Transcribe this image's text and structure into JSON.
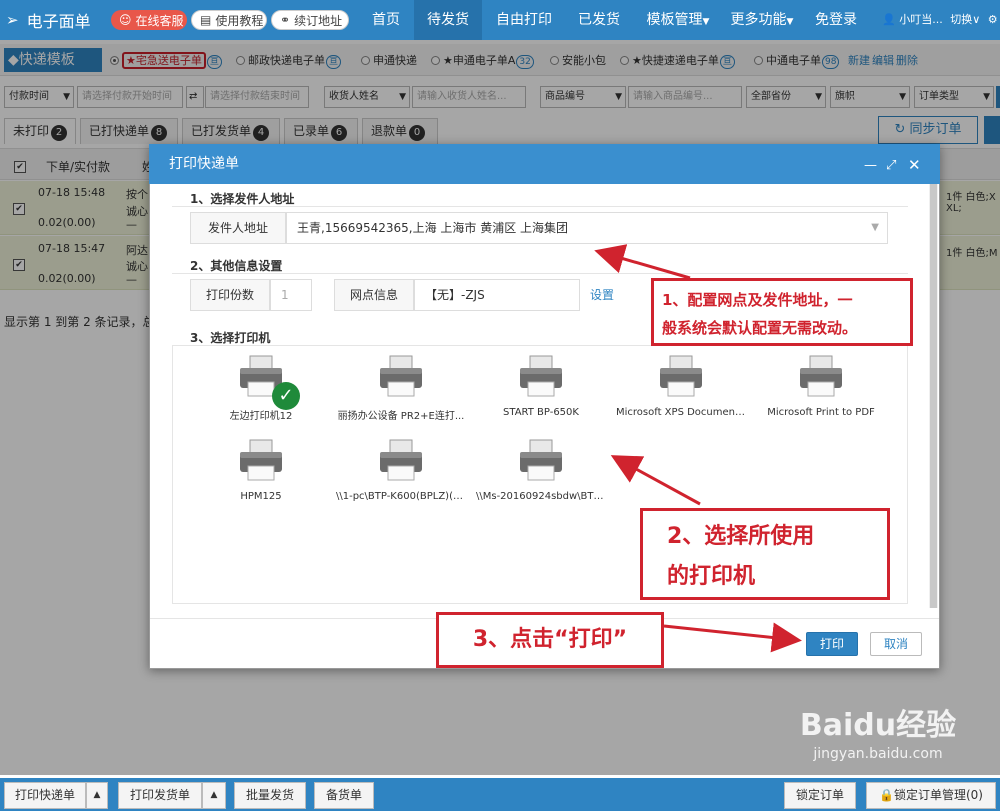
{
  "app": {
    "title": "电子面单",
    "online_service": "在线客服",
    "tutorial": "使用教程",
    "renew": "续订地址"
  },
  "nav": {
    "home": "首页",
    "pending": "待发货",
    "free_print": "自由打印",
    "shipped": "已发货",
    "template_mgmt": "模板管理",
    "more": "更多功能",
    "no_login": "免登录",
    "user": "小叮当...",
    "switch": "切换"
  },
  "templates": {
    "title": "快递模板",
    "items": [
      {
        "label": "★宅急送电子单",
        "badge": "",
        "selected": true
      },
      {
        "label": "邮政快递电子单",
        "badge": "",
        "selected": false
      },
      {
        "label": "申通快递",
        "badge": "",
        "selected": false
      },
      {
        "label": "★申通电子单A",
        "badge": "32",
        "selected": false
      },
      {
        "label": "安能小包",
        "badge": "",
        "selected": false
      },
      {
        "label": "★快捷速递电子单",
        "badge": "",
        "selected": false
      },
      {
        "label": "中通电子单",
        "badge": "98",
        "selected": false
      }
    ],
    "add": "新建",
    "edit": "编辑",
    "delete": "删除"
  },
  "filters": {
    "pay_time": "付款时间",
    "start_ph": "请选择付款开始时间",
    "end_ph": "请选择付款结束时间",
    "receiver": "收货人姓名",
    "receiver_ph": "请输入收货人姓名...",
    "product": "商品编号",
    "product_ph": "请输入商品编号...",
    "province": "全部省份",
    "flag": "旗帜",
    "order_type": "订单类型"
  },
  "tabs": [
    {
      "label": "未打印",
      "count": "2"
    },
    {
      "label": "已打快递单",
      "count": "8"
    },
    {
      "label": "已打发货单",
      "count": "4"
    },
    {
      "label": "已录单",
      "count": "6"
    },
    {
      "label": "退款单",
      "count": "0"
    }
  ],
  "sync_btn": "同步订单",
  "table": {
    "col_time": "下单/实付款",
    "col_buyer": "姓",
    "rows": [
      {
        "time": "07-18 15:48",
        "amount": "0.02(0.00)",
        "buyer1": "按个",
        "buyer2": "诚心",
        "dash": "—",
        "right1": "1件 白色;X",
        "right2": "XL;"
      },
      {
        "time": "07-18 15:47",
        "amount": "0.02(0.00)",
        "buyer1": "阿达",
        "buyer2": "诚心",
        "dash": "—",
        "right1": "1件 白色;M",
        "right2": ""
      }
    ]
  },
  "summary": "显示第 1 到第 2 条记录，总",
  "modal": {
    "title": "打印快递单",
    "s1": "1、选择发件人地址",
    "sender_label": "发件人地址",
    "sender_value": "王青,15669542365,上海 上海市 黄浦区 上海集团",
    "s2": "2、其他信息设置",
    "copies_label": "打印份数",
    "copies_value": "1",
    "outlet_label": "网点信息",
    "outlet_value": "【无】-ZJS",
    "settings_link": "设置",
    "s3": "3、选择打印机",
    "printers": [
      "左边打印机12",
      "丽扬办公设备 PR2+E连打...",
      "START BP-650K",
      "Microsoft XPS Document ...",
      "Microsoft Print to PDF",
      "HPM125",
      "\\\\1-pc\\BTP-K600(BPLZ)(U)1",
      "\\\\Ms-20160924sbdw\\BTP-..."
    ],
    "print_btn": "打印",
    "cancel_btn": "取消"
  },
  "annotations": {
    "a1_line1": "1、配置网点及发件地址，一",
    "a1_line2": "般系统会默认配置无需改动。",
    "a2_line1": "2、选择所使用",
    "a2_line2": "的打印机",
    "a3": "3、点击“打印”"
  },
  "bottom": {
    "print_express": "打印快递单",
    "print_delivery": "打印发货单",
    "batch_ship": "批量发货",
    "stock_list": "备货单",
    "lock_order": "锁定订单",
    "lock_mgmt": "锁定订单管理(0)"
  },
  "watermark": {
    "brand": "Baidu经验",
    "url": "jingyan.baidu.com"
  },
  "colors": {
    "primary": "#2f84c2",
    "annotation": "#d0232e"
  }
}
